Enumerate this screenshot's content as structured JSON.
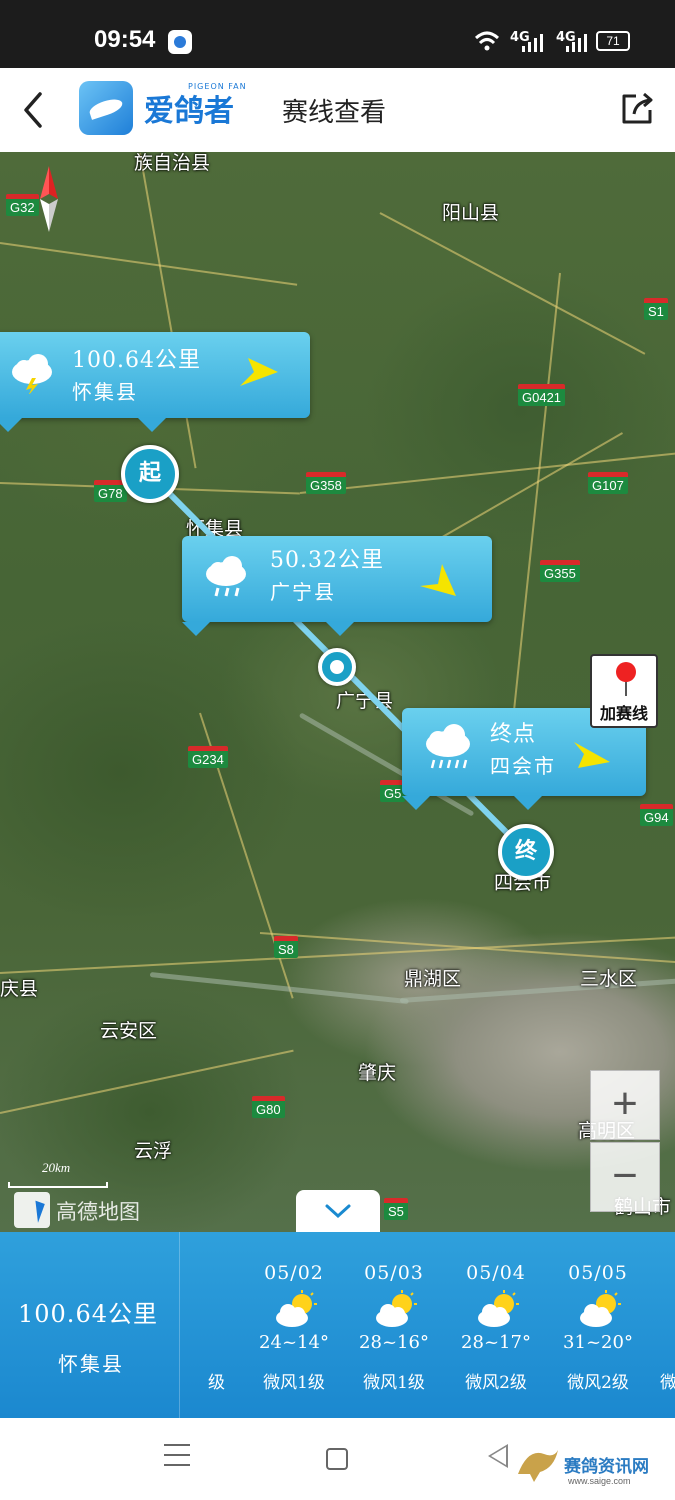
{
  "status_bar": {
    "time": "09:54",
    "signal1": "4G",
    "signal2": "4G",
    "battery": "71"
  },
  "header": {
    "logo_text": "爱鸽者",
    "logo_sub": "PIGEON FAN",
    "title": "赛线查看"
  },
  "map": {
    "places": [
      "族自治县",
      "阳山县",
      "怀集县",
      "广宁县",
      "四会市",
      "鼎湖区",
      "三水区",
      "庆县",
      "云安区",
      "肇庆",
      "高明区",
      "云浮",
      "鹤山市"
    ],
    "road_shields": [
      "G32",
      "S1",
      "G0421",
      "G78",
      "G358",
      "G107",
      "G355",
      "G234",
      "G5",
      "G94",
      "S8",
      "G80",
      "S5"
    ],
    "popups": [
      {
        "distance": "100.64公里",
        "county": "怀集县",
        "weather_icon": "thunderstorm-cloud-icon"
      },
      {
        "distance": "50.32公里",
        "county": "广宁县",
        "weather_icon": "rain-cloud-icon"
      },
      {
        "distance": "终点",
        "county": "四会市",
        "weather_icon": "heavy-rain-cloud-icon"
      }
    ],
    "start_marker": "起",
    "end_marker": "终",
    "add_route_label": "加赛线",
    "zoom_in": "+",
    "zoom_out": "−",
    "scale_label": "20km",
    "map_provider": "高德地图",
    "route_color": "#7fd3ee"
  },
  "weather_panel": {
    "distance": "100.64公里",
    "county": "怀集县",
    "partial_left": "级",
    "days": [
      {
        "date": "05/02",
        "temp": "24~14°",
        "wind": "微风1级",
        "icon": "partly-cloudy-icon"
      },
      {
        "date": "05/03",
        "temp": "28~16°",
        "wind": "微风1级",
        "icon": "partly-cloudy-icon"
      },
      {
        "date": "05/04",
        "temp": "28~17°",
        "wind": "微风2级",
        "icon": "partly-cloudy-icon"
      },
      {
        "date": "05/05",
        "temp": "31~20°",
        "wind": "微风2级",
        "icon": "partly-cloudy-icon"
      }
    ],
    "partial_right": "微"
  },
  "watermark": {
    "name": "赛鸽资讯网",
    "url": "www.saige.com"
  }
}
